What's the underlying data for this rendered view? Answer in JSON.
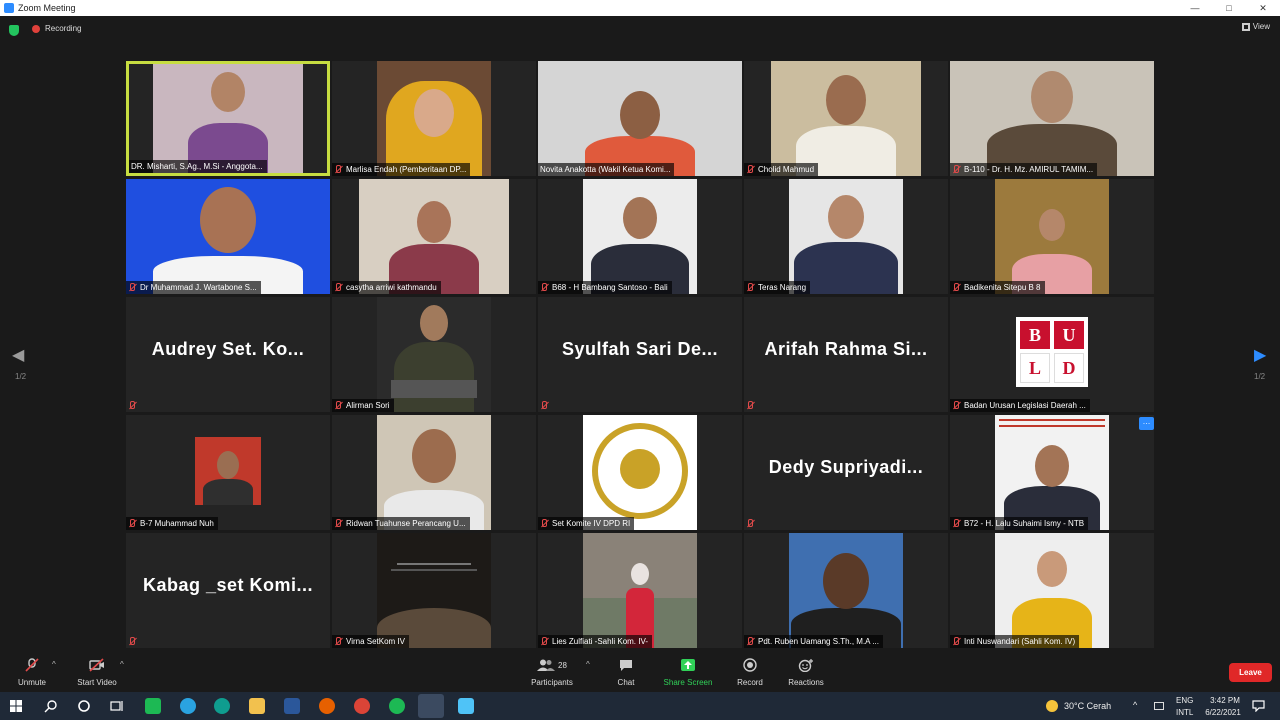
{
  "window": {
    "title": "Zoom Meeting"
  },
  "header": {
    "recording_label": "Recording",
    "view_label": "View"
  },
  "nav": {
    "page_left": "1/2",
    "page_right": "1/2"
  },
  "tiles": [
    {
      "name": "DR. Misharti, S.Ag., M.Si - Anggota..."
    },
    {
      "name": "Marlisa Endah (Pemberitaan DP..."
    },
    {
      "name": "Novita Anakotta (Wakil Ketua Komi..."
    },
    {
      "name": "Cholid Mahmud"
    },
    {
      "name": "B-110 - Dr. H. Mz. AMIRUL TAMIM..."
    },
    {
      "name": "Dr Muhammad J. Wartabone S..."
    },
    {
      "name": "casytha arriwi kathmandu"
    },
    {
      "name": "B68 - H Bambang Santoso - Bali"
    },
    {
      "name": "Teras Narang"
    },
    {
      "name": "Badikenita Sitepu B 8"
    },
    {
      "name": "",
      "display": "Audrey Set. Ko..."
    },
    {
      "name": "Alirman Sori"
    },
    {
      "name": "",
      "display": "Syulfah Sari De..."
    },
    {
      "name": "",
      "display": "Arifah Rahma Si..."
    },
    {
      "name": "Badan Urusan Legislasi Daerah ...",
      "logo_letters": [
        "B",
        "U",
        "L",
        "D"
      ]
    },
    {
      "name": "B-7 Muhammad Nuh"
    },
    {
      "name": "Ridwan Tuahunse Perancang U..."
    },
    {
      "name": "Set Komite IV DPD RI"
    },
    {
      "name": "",
      "display": "Dedy Supriyadi..."
    },
    {
      "name": "B72 - H. Lalu Suhaimi Ismy - NTB"
    },
    {
      "name": "",
      "display": "Kabag _set Komi..."
    },
    {
      "name": "Virna SetKom IV"
    },
    {
      "name": "Lies Zulfiati -Sahli Kom. IV-"
    },
    {
      "name": "Pdt. Ruben Uamang S.Th., M.A ..."
    },
    {
      "name": "Inti Nuswandari (Sahli Kom. IV)"
    }
  ],
  "toolbar": {
    "unmute": "Unmute",
    "start_video": "Start Video",
    "participants": "Participants",
    "participants_count": "28",
    "chat": "Chat",
    "share_screen": "Share Screen",
    "record": "Record",
    "reactions": "Reactions",
    "leave": "Leave"
  },
  "taskbar": {
    "weather": "30°C  Cerah",
    "lang_top": "ENG",
    "lang_bottom": "INTL",
    "time": "3:42 PM",
    "date": "6/22/2021"
  },
  "colors": {
    "active_speaker": "#c7dd41",
    "share_green": "#30d158",
    "leave_red": "#e02828",
    "accent_blue": "#2d8cff"
  }
}
